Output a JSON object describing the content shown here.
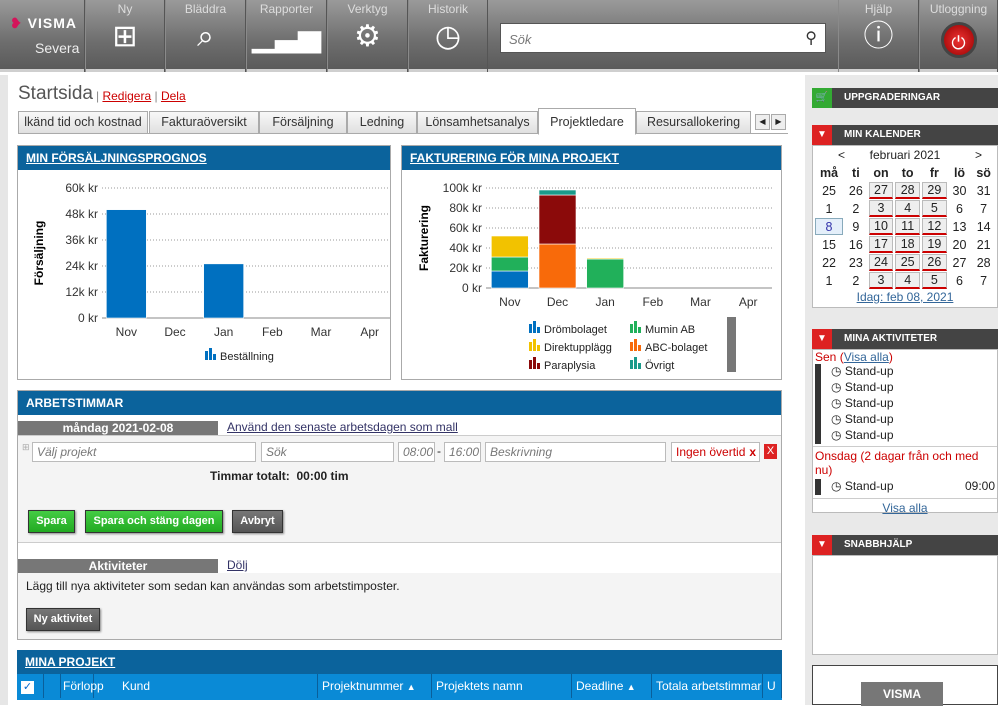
{
  "topbar": {
    "brand": "VISMA",
    "product": "Severa",
    "nav": [
      {
        "label": "Ny",
        "icon": "new-icon"
      },
      {
        "label": "Bläddra",
        "icon": "browse-icon"
      },
      {
        "label": "Rapporter",
        "icon": "reports-icon"
      },
      {
        "label": "Verktyg",
        "icon": "tools-icon"
      },
      {
        "label": "Historik",
        "icon": "history-icon"
      }
    ],
    "search_placeholder": "Sök",
    "help": "Hjälp",
    "logout": "Utloggning"
  },
  "page": {
    "title": "Startsida",
    "edit": "Redigera",
    "share": "Dela",
    "tabs": [
      "lkänd tid och kostnad",
      "Fakturaöversikt",
      "Försäljning",
      "Ledning",
      "Lönsamhetsanalys",
      "Projektledare",
      "Resursallokering"
    ],
    "active_tab": "Projektledare"
  },
  "chart_data": [
    {
      "type": "bar",
      "title": "MIN FÖRSÄLJNINGSPROGNOS",
      "ylabel": "Försäljning",
      "categories": [
        "Nov",
        "Dec",
        "Jan",
        "Feb",
        "Mar",
        "Apr"
      ],
      "yticks": [
        "0 kr",
        "12k kr",
        "24k kr",
        "36k kr",
        "48k kr",
        "60k kr"
      ],
      "ylim": [
        0,
        60000
      ],
      "series": [
        {
          "name": "Beställning",
          "color": "#0070c0",
          "values": [
            50000,
            0,
            25000,
            0,
            0,
            0
          ]
        }
      ],
      "legend": "bottom"
    },
    {
      "type": "bar",
      "stacked": true,
      "title": "FAKTURERING FÖR MINA PROJEKT",
      "ylabel": "Fakturering",
      "categories": [
        "Nov",
        "Dec",
        "Jan",
        "Feb",
        "Mar",
        "Apr"
      ],
      "yticks": [
        "0 kr",
        "20k kr",
        "40k kr",
        "60k kr",
        "80k kr",
        "100k kr"
      ],
      "ylim": [
        0,
        100000
      ],
      "legend": "bottom",
      "series": [
        {
          "name": "Drömbolaget",
          "color": "#0070c0",
          "values": [
            17000,
            0,
            0,
            0,
            0,
            0
          ]
        },
        {
          "name": "Mumin AB",
          "color": "#21b05a",
          "values": [
            14000,
            0,
            29000,
            0,
            0,
            0
          ]
        },
        {
          "name": "Direktupplägg",
          "color": "#f2c200",
          "values": [
            21000,
            0,
            1000,
            0,
            0,
            0
          ]
        },
        {
          "name": "ABC-bolaget",
          "color": "#f86a0a",
          "values": [
            0,
            44000,
            0,
            0,
            0,
            0
          ]
        },
        {
          "name": "Paraplysia",
          "color": "#8b0a0a",
          "values": [
            0,
            49000,
            0,
            0,
            0,
            0
          ]
        },
        {
          "name": "Övrigt",
          "color": "#1a9a8a",
          "values": [
            0,
            5000,
            0,
            0,
            0,
            0
          ]
        }
      ]
    }
  ],
  "work": {
    "title": "ARBETSTIMMAR",
    "date": "måndag 2021-02-08",
    "template_link": "Använd den senaste arbetsdagen som mall",
    "project_ph": "Välj projekt",
    "search_ph": "Sök",
    "start": "08:00",
    "end": "16:00",
    "desc_ph": "Beskrivning",
    "overtime": "Ingen övertid",
    "total_label": "Timmar totalt:",
    "total": "00:00 tim",
    "save": "Spara",
    "save_close": "Spara och stäng dagen",
    "cancel": "Avbryt",
    "activities_tab": "Aktiviteter",
    "hide": "Dölj",
    "activities_text": "Lägg till nya aktiviteter som sedan kan användas som arbetstimposter.",
    "new_activity": "Ny aktivitet"
  },
  "projects": {
    "title": "MINA PROJEKT",
    "columns": [
      "Förlopp",
      "Kund",
      "Projektnummer",
      "Projektets namn",
      "Deadline",
      "Totala arbetstimmar",
      "U"
    ]
  },
  "sidebar": {
    "upgrades": "UPPGRADERINGAR",
    "calendar": {
      "title": "MIN KALENDER",
      "month": "februari 2021",
      "prev": "<",
      "next": ">",
      "days": [
        "må",
        "ti",
        "on",
        "to",
        "fr",
        "lö",
        "sö"
      ],
      "weeks": [
        [
          "25",
          "26",
          "27",
          "28",
          "29",
          "30",
          "31"
        ],
        [
          "1",
          "2",
          "3",
          "4",
          "5",
          "6",
          "7"
        ],
        [
          "8",
          "9",
          "10",
          "11",
          "12",
          "13",
          "14"
        ],
        [
          "15",
          "16",
          "17",
          "18",
          "19",
          "20",
          "21"
        ],
        [
          "22",
          "23",
          "24",
          "25",
          "26",
          "27",
          "28"
        ],
        [
          "1",
          "2",
          "3",
          "4",
          "5",
          "6",
          "7"
        ]
      ],
      "today": "Idag: feb 08, 2021"
    },
    "activities": {
      "title": "MINA AKTIVITETER",
      "late": "Sen",
      "show_all_inline": "Visa alla",
      "late_items": [
        "Stand-up",
        "Stand-up",
        "Stand-up",
        "Stand-up",
        "Stand-up"
      ],
      "upcoming": "Onsdag (2 dagar från och med nu)",
      "upcoming_item": "Stand-up",
      "upcoming_time": "09:00",
      "show_all": "Visa alla"
    },
    "quickhelp": "SNABBHJÄLP",
    "footer_brand": "VISMA"
  }
}
